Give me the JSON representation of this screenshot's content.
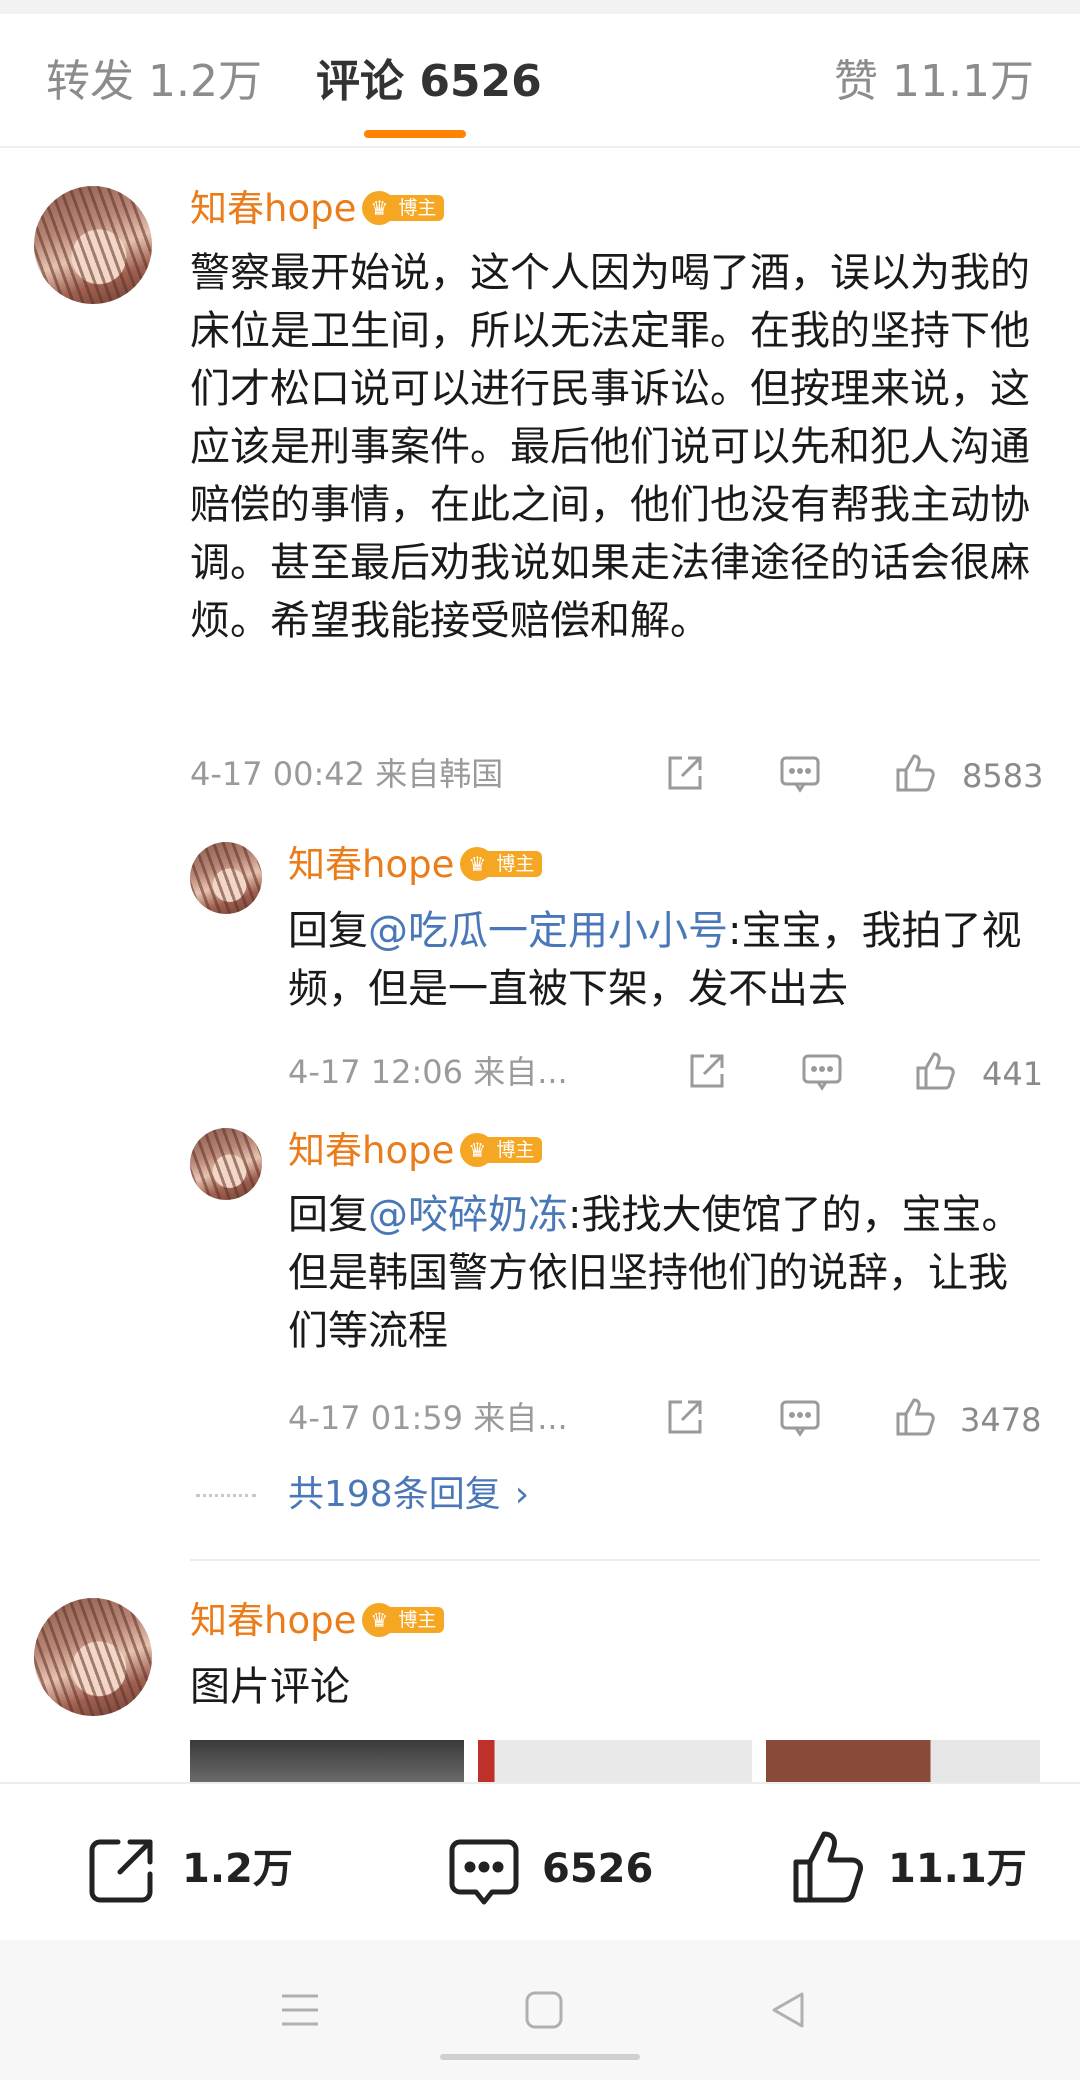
{
  "tabs": {
    "repost": "转发 1.2万",
    "comment": "评论 6526",
    "like": "赞 11.1万"
  },
  "comments": [
    {
      "name": "知春hope",
      "badge": "博主",
      "text": "警察最开始说，这个人因为喝了酒，误以为我的床位是卫生间，所以无法定罪。在我的坚持下他们才松口说可以进行民事诉讼。但按理来说，这应该是刑事案件。最后他们说可以先和犯人沟通赔偿的事情，在此之间，他们也没有帮我主动协调。甚至最后劝我说如果走法律途径的话会很麻烦。希望我能接受赔偿和解。",
      "meta": "4-17 00:42  来自韩国",
      "likes": "8583"
    }
  ],
  "replies": [
    {
      "name": "知春hope",
      "badge": "博主",
      "prefix": "回复",
      "mention": "@吃瓜一定用小小号",
      "text": ":宝宝，我拍了视频，但是一直被下架，发不出去",
      "meta": "4-17 12:06  来自...",
      "likes": "441"
    },
    {
      "name": "知春hope",
      "badge": "博主",
      "prefix": "回复",
      "mention": "@咬碎奶冻",
      "text": ":我找大使馆了的，宝宝。但是韩国警方依旧坚持他们的说辞，让我们等流程",
      "meta": "4-17 01:59  来自...",
      "likes": "3478"
    }
  ],
  "more_replies": "共198条回复",
  "comment2": {
    "name": "知春hope",
    "badge": "博主",
    "text": "图片评论"
  },
  "bottom_bar": {
    "repost_count": "1.2万",
    "comment_count": "6526",
    "like_count": "11.1万"
  },
  "colors": {
    "accent": "#ff8200",
    "username": "#eb7c1a",
    "link": "#4a77b8",
    "meta": "#9a9a9a"
  },
  "icons": [
    "share-icon",
    "comment-icon",
    "thumbs-up-icon",
    "chevron-right-icon",
    "menu-icon",
    "home-icon",
    "back-icon",
    "crown-icon"
  ]
}
